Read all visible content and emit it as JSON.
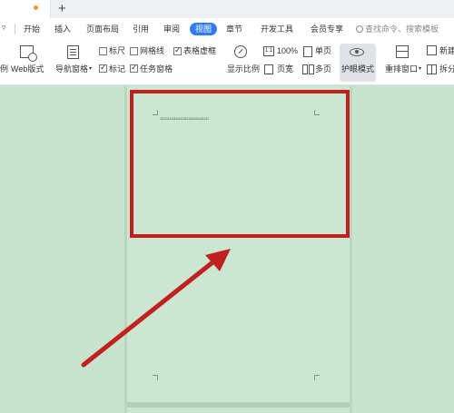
{
  "tabs": {
    "new_tab_label": "+"
  },
  "menu": {
    "left_glyph": "▿",
    "items": [
      "开始",
      "插入",
      "页面布局",
      "引用",
      "审阅",
      "视图",
      "章节",
      "开发工具",
      "会员专享"
    ],
    "active": "视图",
    "search_placeholder": "查找命令、搜索模板"
  },
  "ribbon": {
    "partial_left": "例",
    "web_layout": "Web版式",
    "nav_pane": "导航窗格",
    "checkboxes": {
      "ruler": {
        "label": "标尺",
        "checked": false
      },
      "gridlines": {
        "label": "网格线",
        "checked": false
      },
      "table_grid": {
        "label": "表格虚框",
        "checked": true
      },
      "marks": {
        "label": "标记",
        "checked": true
      },
      "task_pane": {
        "label": "任务窗格",
        "checked": true
      }
    },
    "zoom_ratio": "显示比例",
    "zoom_100": "100%",
    "page_width": "页宽",
    "single_page": "单页",
    "multi_page": "多页",
    "eye_mode": "护眼模式",
    "rearrange_window": "重排窗口",
    "new_window": "新建",
    "split_window": "拆分"
  },
  "document": {
    "text_line": "1111111111111111111111111111111"
  },
  "colors": {
    "accent": "#2f7cf6",
    "eye_mode_bg": "#c8e3ce",
    "annotation_red": "#c0201e"
  }
}
